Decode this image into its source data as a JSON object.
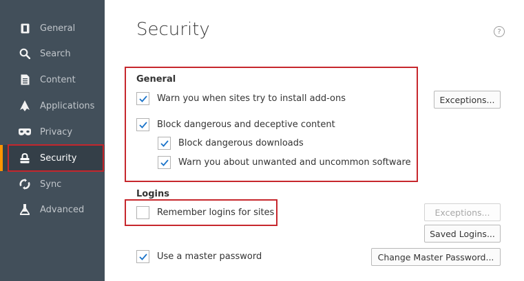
{
  "sidebar": {
    "items": [
      {
        "label": "General",
        "icon": "general-icon"
      },
      {
        "label": "Search",
        "icon": "search-icon"
      },
      {
        "label": "Content",
        "icon": "content-icon"
      },
      {
        "label": "Applications",
        "icon": "applications-icon"
      },
      {
        "label": "Privacy",
        "icon": "privacy-mask-icon"
      },
      {
        "label": "Security",
        "icon": "lock-icon",
        "active": true
      },
      {
        "label": "Sync",
        "icon": "sync-icon"
      },
      {
        "label": "Advanced",
        "icon": "advanced-icon"
      }
    ]
  },
  "page": {
    "title": "Security",
    "help_glyph": "?"
  },
  "general": {
    "heading": "General",
    "warn_addons": {
      "label": "Warn you when sites try to install add-ons",
      "checked": true
    },
    "block_dangerous": {
      "label": "Block dangerous and deceptive content",
      "checked": true
    },
    "block_downloads": {
      "label": "Block dangerous downloads",
      "checked": true
    },
    "warn_unwanted": {
      "label": "Warn you about unwanted and uncommon software",
      "checked": true
    },
    "exceptions_button": "Exceptions..."
  },
  "logins": {
    "heading": "Logins",
    "remember": {
      "label": "Remember logins for sites",
      "checked": false
    },
    "exceptions_button": "Exceptions...",
    "saved_logins_button": "Saved Logins...",
    "master_password": {
      "label": "Use a master password",
      "checked": true
    },
    "change_master_button": "Change Master Password..."
  },
  "colors": {
    "sidebar_bg": "#424f5a",
    "highlight_red": "#c6262c",
    "check_blue": "#1a73c9",
    "active_accent": "#ff9500"
  }
}
